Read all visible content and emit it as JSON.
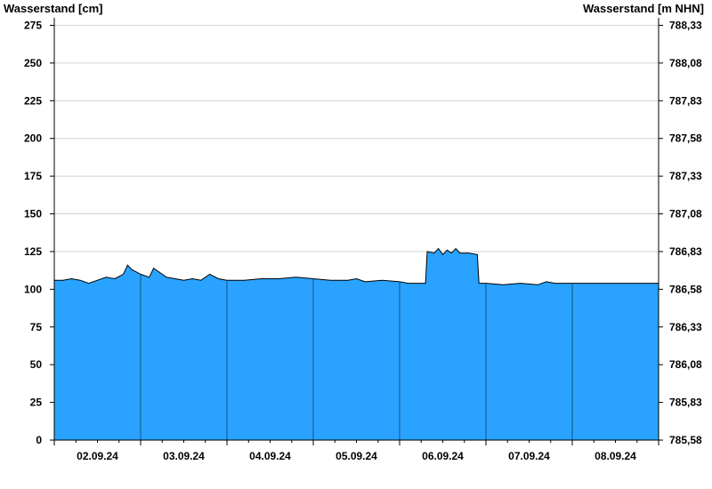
{
  "chart_data": {
    "type": "area",
    "ylabel_left": "Wasserstand [cm]",
    "ylabel_right": "Wasserstand [m NHN]",
    "ylim": [
      0,
      280
    ],
    "y_ticks": [
      0,
      25,
      50,
      75,
      100,
      125,
      150,
      175,
      200,
      225,
      250,
      275
    ],
    "y2_ticks": [
      "785,58",
      "785,83",
      "786,08",
      "786,33",
      "786,58",
      "786,83",
      "787,08",
      "787,33",
      "787,58",
      "787,83",
      "788,08",
      "788,33"
    ],
    "x_day_labels": [
      "02.09.24",
      "03.09.24",
      "04.09.24",
      "05.09.24",
      "06.09.24",
      "07.09.24",
      "08.09.24"
    ],
    "x_range_days": [
      0,
      7
    ],
    "grid": "horizontal",
    "colors": {
      "fill": "#29a3ff",
      "line": "#000000",
      "grid": "#d0d0d0",
      "day_separator": "#1a4f80"
    },
    "series": [
      {
        "points": [
          [
            0.0,
            106
          ],
          [
            0.1,
            106
          ],
          [
            0.2,
            107
          ],
          [
            0.3,
            106
          ],
          [
            0.4,
            104
          ],
          [
            0.5,
            106
          ],
          [
            0.6,
            108
          ],
          [
            0.7,
            107
          ],
          [
            0.8,
            110
          ],
          [
            0.85,
            116
          ],
          [
            0.9,
            113
          ],
          [
            1.0,
            110
          ],
          [
            1.1,
            108
          ],
          [
            1.15,
            114
          ],
          [
            1.2,
            112
          ],
          [
            1.3,
            108
          ],
          [
            1.4,
            107
          ],
          [
            1.5,
            106
          ],
          [
            1.6,
            107
          ],
          [
            1.7,
            106
          ],
          [
            1.8,
            110
          ],
          [
            1.9,
            107
          ],
          [
            2.0,
            106
          ],
          [
            2.2,
            106
          ],
          [
            2.4,
            107
          ],
          [
            2.6,
            107
          ],
          [
            2.8,
            108
          ],
          [
            3.0,
            107
          ],
          [
            3.2,
            106
          ],
          [
            3.4,
            106
          ],
          [
            3.5,
            107
          ],
          [
            3.6,
            105
          ],
          [
            3.8,
            106
          ],
          [
            4.0,
            105
          ],
          [
            4.1,
            104
          ],
          [
            4.2,
            104
          ],
          [
            4.3,
            104
          ],
          [
            4.32,
            125
          ],
          [
            4.4,
            124
          ],
          [
            4.45,
            127
          ],
          [
            4.5,
            123
          ],
          [
            4.55,
            126
          ],
          [
            4.6,
            124
          ],
          [
            4.65,
            127
          ],
          [
            4.7,
            124
          ],
          [
            4.8,
            124
          ],
          [
            4.9,
            123
          ],
          [
            4.92,
            104
          ],
          [
            5.0,
            104
          ],
          [
            5.2,
            103
          ],
          [
            5.4,
            104
          ],
          [
            5.6,
            103
          ],
          [
            5.7,
            105
          ],
          [
            5.8,
            104
          ],
          [
            6.0,
            104
          ],
          [
            6.2,
            104
          ],
          [
            6.4,
            104
          ],
          [
            6.6,
            104
          ],
          [
            6.8,
            104
          ],
          [
            7.0,
            104
          ]
        ]
      }
    ]
  }
}
